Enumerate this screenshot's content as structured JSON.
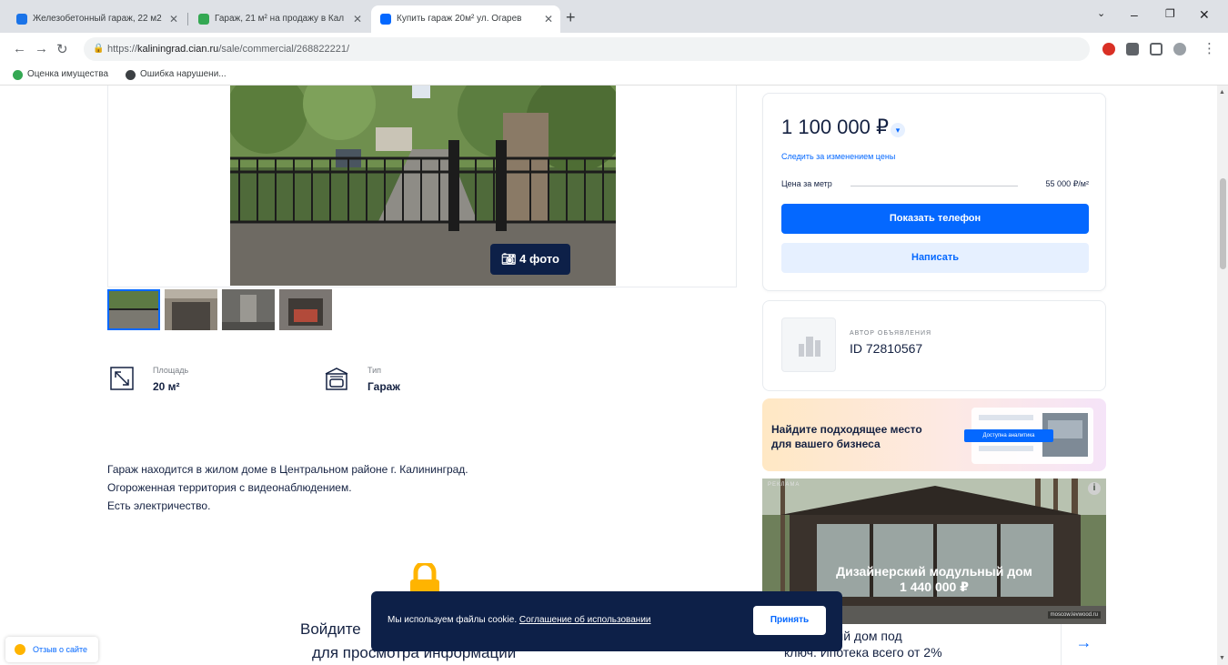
{
  "browser": {
    "tabs": [
      {
        "title": "Железобетонный гараж, 22 м2",
        "favicon_color": "#1a73e8"
      },
      {
        "title": "Гараж, 21 м² на продажу в Кал",
        "favicon_color": "#34a853"
      },
      {
        "title": "Купить гараж 20м² ул. Огарев",
        "favicon_color": "#0468ff"
      }
    ],
    "tab_close_glyph": "✕",
    "new_tab_glyph": "+",
    "url_prefix": "https://",
    "url_host": "kaliningrad.cian.ru",
    "url_path": "/sale/commercial/268822221/",
    "bookmarks": [
      {
        "label": "Оценка имущества",
        "icon_color": "#34a853"
      },
      {
        "label": "Ошибка нарушени...",
        "icon_color": "#3c4043"
      }
    ]
  },
  "listing": {
    "photo_count_label": "4 фото",
    "features": [
      {
        "label": "Площадь",
        "value": "20 м²",
        "icon": "area-icon"
      },
      {
        "label": "Тип",
        "value": "Гараж",
        "icon": "garage-icon"
      }
    ],
    "description": [
      "Гараж находится в жилом доме в Центральном районе г. Калининград.",
      "Огороженная территория с видеонаблюдением.",
      "Есть электричество."
    ],
    "login_title": "Войдите",
    "login_subtitle": "для просмотра информации"
  },
  "price_card": {
    "price": "1 100 000 ₽",
    "watch_price": "Следить за изменением цены",
    "price_per_meter_label": "Цена за метр",
    "price_per_meter_value": "55 000 ₽/м²",
    "show_phone": "Показать телефон",
    "write": "Написать"
  },
  "author": {
    "label": "АВТОР ОБЪЯВЛЕНИЯ",
    "id": "ID 72810567"
  },
  "promo": {
    "line1": "Найдите подходящее место",
    "line2": "для вашего бизнеса",
    "badge": "Доступна аналитика"
  },
  "ad": {
    "tag": "РЕКЛАМА",
    "info_glyph": "i",
    "caption_line1": "Дизайнерский модульный дом",
    "caption_line2": "1 440 000 ₽",
    "domain": "moscow.levwood.ru",
    "bottom_line1": "модульный дом под",
    "bottom_line2": "ключ. Ипотека всего от 2%",
    "arrow_glyph": "→"
  },
  "cookie": {
    "text": "Мы используем файлы cookie.",
    "link": "Соглашение об использовании",
    "accept": "Принять"
  },
  "feedback": {
    "label": "Отзыв о сайте"
  }
}
